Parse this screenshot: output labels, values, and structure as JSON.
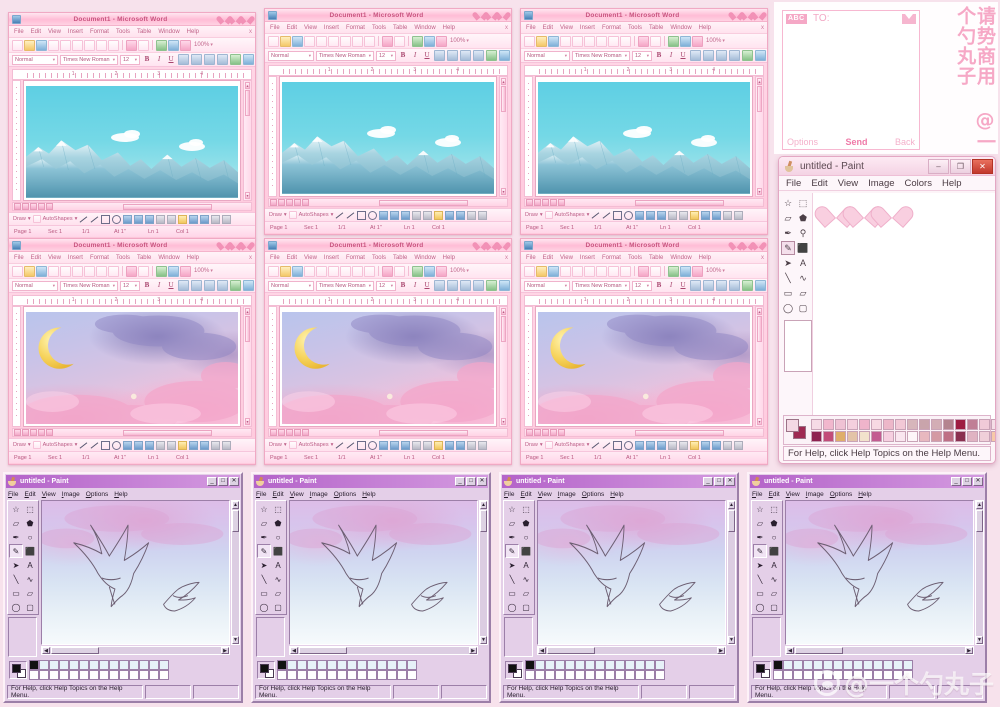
{
  "word": {
    "title": "Document1 - Microsoft Word",
    "window_buttons": [
      "minimize-heart",
      "maximize-heart",
      "close-heart"
    ],
    "menus": [
      "File",
      "Edit",
      "View",
      "Insert",
      "Format",
      "Tools",
      "Table",
      "Window",
      "Help"
    ],
    "menubar_close": "x",
    "toolbar": {
      "zoom": "100%",
      "caret": "▾"
    },
    "formatting": {
      "style": "Normal",
      "font": "Times New Roman",
      "size": "12",
      "bold": "B",
      "italic": "I",
      "underline": "U"
    },
    "ruler_numbers": [
      "1",
      "2",
      "3",
      "4"
    ],
    "drawing": {
      "draw_label": "Draw",
      "autoshapes_label": "AutoShapes",
      "caret": "▾"
    },
    "status": {
      "page": "Page 1",
      "section": "Sec 1",
      "pages": "1/1",
      "at": "At 1\"",
      "line": "Ln 1",
      "column": "Col 1"
    },
    "documents": [
      {
        "art": "mountains"
      },
      {
        "art": "mountains"
      },
      {
        "art": "mountains"
      },
      {
        "art": "moon-clouds"
      },
      {
        "art": "moon-clouds"
      },
      {
        "art": "moon-clouds"
      }
    ]
  },
  "phone_sms": {
    "input_mode": "ABC",
    "to_label": "TO:",
    "envelope_icon": "envelope-icon",
    "actions": {
      "left": "Options",
      "center": "Send",
      "right": "Back"
    },
    "watermark": "请势商用 @一个勺丸子"
  },
  "paint_win7": {
    "title": "untitled - Paint",
    "window_buttons": [
      "–",
      "❐",
      "✕"
    ],
    "menus": [
      "File",
      "Edit",
      "View",
      "Image",
      "Colors",
      "Help"
    ],
    "tools": [
      "free-form-select-icon",
      "rectangle-select-icon",
      "eraser-icon",
      "fill-icon",
      "color-picker-icon",
      "magnifier-icon",
      "pencil-icon",
      "airbrush-icon",
      "brush-icon",
      "text-icon",
      "line-icon",
      "curve-icon",
      "rectangle-icon",
      "polygon-icon",
      "ellipse-icon",
      "rounded-rectangle-icon"
    ],
    "selected_tool": "pencil-icon",
    "palette_row1": [
      "#f6dbe6",
      "#f1b7cd",
      "#efc2d4",
      "#f4cfdd",
      "#efb4cb",
      "#f7d9e3",
      "#edb7c9",
      "#f2c8d6",
      "#d7b6bb",
      "#c9a4ab",
      "#d3adb5",
      "#b4838f",
      "#9e1c42",
      "#c07f96",
      "#f0cad8",
      "#f5dee7"
    ],
    "palette_row2": [
      "#8e2250",
      "#c24c79",
      "#dfae6a",
      "#e3c3a8",
      "#f2e2cc",
      "#c35b91",
      "#f6cfe0",
      "#f9e6ef",
      "#fdf5f8",
      "#e8b8bf",
      "#d49aa4",
      "#be6f85",
      "#8a3050",
      "#e0b3c2",
      "#f0cfd9",
      "#f7c9a8"
    ],
    "current_fg": "#f4d8e4",
    "current_bg": "#9e2a52",
    "status": "For Help, click Help Topics on the Help Menu.",
    "canvas_drawing": "three-pink-hearts"
  },
  "paint_win98": {
    "title": "untitled - Paint",
    "window_buttons": [
      "_",
      "□",
      "✕"
    ],
    "menus": [
      "File",
      "Edit",
      "View",
      "Image",
      "Options",
      "Help"
    ],
    "tools": [
      "free-form-select-icon",
      "rectangle-select-icon",
      "eraser-icon",
      "fill-icon",
      "color-picker-icon",
      "magnifier-icon",
      "pencil-icon",
      "airbrush-icon",
      "brush-icon",
      "text-icon",
      "line-icon",
      "curve-icon",
      "rectangle-icon",
      "polygon-icon",
      "ellipse-icon",
      "rounded-rectangle-icon"
    ],
    "selected_tool": "pencil-icon",
    "current_fg": "#111111",
    "current_bg": "#ffffff",
    "status": "For Help, click Help Topics on the Help Menu.",
    "status_pos": "",
    "status_size": "",
    "canvas_drawing": "two-flying-birds-on-pastel-sky",
    "instances": 4
  },
  "watermark": {
    "handle": "@一个勺丸子",
    "logo": "weibo-logo-icon"
  }
}
